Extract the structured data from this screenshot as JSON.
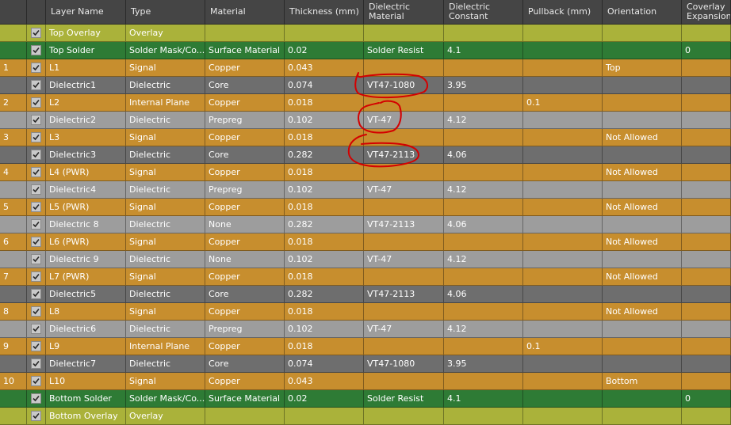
{
  "colors": {
    "overlay": "#aab23a",
    "solder": "#2e7b35",
    "signal": "#c78e2e",
    "dielectric_core": "#6e6e6e",
    "dielectric_prepreg": "#9d9d9d",
    "header": "#454545",
    "annotation": "#d40000"
  },
  "columns": [
    {
      "key": "num",
      "label": ""
    },
    {
      "key": "check",
      "label": ""
    },
    {
      "key": "name",
      "label": "Layer Name"
    },
    {
      "key": "type",
      "label": "Type"
    },
    {
      "key": "material",
      "label": "Material"
    },
    {
      "key": "thickness",
      "label": "Thickness (mm)"
    },
    {
      "key": "diel_material",
      "label": "Dielectric\nMaterial"
    },
    {
      "key": "diel_constant",
      "label": "Dielectric\nConstant"
    },
    {
      "key": "pullback",
      "label": "Pullback (mm)"
    },
    {
      "key": "orientation",
      "label": "Orientation"
    },
    {
      "key": "coverlay",
      "label": "Coverlay\nExpansion"
    }
  ],
  "rows": [
    {
      "style": "overlay",
      "num": "",
      "checked": true,
      "name": "Top Overlay",
      "type": "Overlay",
      "material": "",
      "thickness": "",
      "diel_material": "",
      "diel_constant": "",
      "pullback": "",
      "orientation": "",
      "coverlay": ""
    },
    {
      "style": "solder",
      "num": "",
      "checked": true,
      "name": "Top Solder",
      "type": "Solder Mask/Co...",
      "material": "Surface Material",
      "thickness": "0.02",
      "diel_material": "Solder Resist",
      "diel_constant": "4.1",
      "pullback": "",
      "orientation": "",
      "coverlay": "0"
    },
    {
      "style": "signal",
      "num": "1",
      "checked": true,
      "name": "L1",
      "type": "Signal",
      "material": "Copper",
      "thickness": "0.043",
      "diel_material": "",
      "diel_constant": "",
      "pullback": "",
      "orientation": "Top",
      "coverlay": ""
    },
    {
      "style": "dielectric_core",
      "num": "",
      "checked": true,
      "name": "Dielectric1",
      "type": "Dielectric",
      "material": "Core",
      "thickness": "0.074",
      "diel_material": "VT47-1080",
      "diel_constant": "3.95",
      "pullback": "",
      "orientation": "",
      "coverlay": ""
    },
    {
      "style": "signal",
      "num": "2",
      "checked": true,
      "name": "L2",
      "type": "Internal Plane",
      "material": "Copper",
      "thickness": "0.018",
      "diel_material": "",
      "diel_constant": "",
      "pullback": "0.1",
      "orientation": "",
      "coverlay": ""
    },
    {
      "style": "dielectric_prepreg",
      "num": "",
      "checked": true,
      "name": "Dielectric2",
      "type": "Dielectric",
      "material": "Prepreg",
      "thickness": "0.102",
      "diel_material": "VT-47",
      "diel_constant": "4.12",
      "pullback": "",
      "orientation": "",
      "coverlay": ""
    },
    {
      "style": "signal",
      "num": "3",
      "checked": true,
      "name": "L3",
      "type": "Signal",
      "material": "Copper",
      "thickness": "0.018",
      "diel_material": "",
      "diel_constant": "",
      "pullback": "",
      "orientation": "Not Allowed",
      "coverlay": ""
    },
    {
      "style": "dielectric_core",
      "num": "",
      "checked": true,
      "name": "Dielectric3",
      "type": "Dielectric",
      "material": "Core",
      "thickness": "0.282",
      "diel_material": "VT47-2113",
      "diel_constant": "4.06",
      "pullback": "",
      "orientation": "",
      "coverlay": ""
    },
    {
      "style": "signal",
      "num": "4",
      "checked": true,
      "name": "L4 (PWR)",
      "type": "Signal",
      "material": "Copper",
      "thickness": "0.018",
      "diel_material": "",
      "diel_constant": "",
      "pullback": "",
      "orientation": "Not Allowed",
      "coverlay": ""
    },
    {
      "style": "dielectric_prepreg",
      "num": "",
      "checked": true,
      "name": "Dielectric4",
      "type": "Dielectric",
      "material": "Prepreg",
      "thickness": "0.102",
      "diel_material": "VT-47",
      "diel_constant": "4.12",
      "pullback": "",
      "orientation": "",
      "coverlay": ""
    },
    {
      "style": "signal",
      "num": "5",
      "checked": true,
      "name": "L5 (PWR)",
      "type": "Signal",
      "material": "Copper",
      "thickness": "0.018",
      "diel_material": "",
      "diel_constant": "",
      "pullback": "",
      "orientation": "Not Allowed",
      "coverlay": ""
    },
    {
      "style": "dielectric_prepreg",
      "num": "",
      "checked": true,
      "name": "Dielectric 8",
      "type": "Dielectric",
      "material": "None",
      "thickness": "0.282",
      "diel_material": "VT47-2113",
      "diel_constant": "4.06",
      "pullback": "",
      "orientation": "",
      "coverlay": ""
    },
    {
      "style": "signal",
      "num": "6",
      "checked": true,
      "name": "L6 (PWR)",
      "type": "Signal",
      "material": "Copper",
      "thickness": "0.018",
      "diel_material": "",
      "diel_constant": "",
      "pullback": "",
      "orientation": "Not Allowed",
      "coverlay": ""
    },
    {
      "style": "dielectric_prepreg",
      "num": "",
      "checked": true,
      "name": "Dielectric 9",
      "type": "Dielectric",
      "material": "None",
      "thickness": "0.102",
      "diel_material": "VT-47",
      "diel_constant": "4.12",
      "pullback": "",
      "orientation": "",
      "coverlay": ""
    },
    {
      "style": "signal",
      "num": "7",
      "checked": true,
      "name": "L7 (PWR)",
      "type": "Signal",
      "material": "Copper",
      "thickness": "0.018",
      "diel_material": "",
      "diel_constant": "",
      "pullback": "",
      "orientation": "Not Allowed",
      "coverlay": ""
    },
    {
      "style": "dielectric_core",
      "num": "",
      "checked": true,
      "name": "Dielectric5",
      "type": "Dielectric",
      "material": "Core",
      "thickness": "0.282",
      "diel_material": "VT47-2113",
      "diel_constant": "4.06",
      "pullback": "",
      "orientation": "",
      "coverlay": ""
    },
    {
      "style": "signal",
      "num": "8",
      "checked": true,
      "name": "L8",
      "type": "Signal",
      "material": "Copper",
      "thickness": "0.018",
      "diel_material": "",
      "diel_constant": "",
      "pullback": "",
      "orientation": "Not Allowed",
      "coverlay": ""
    },
    {
      "style": "dielectric_prepreg",
      "num": "",
      "checked": true,
      "name": "Dielectric6",
      "type": "Dielectric",
      "material": "Prepreg",
      "thickness": "0.102",
      "diel_material": "VT-47",
      "diel_constant": "4.12",
      "pullback": "",
      "orientation": "",
      "coverlay": ""
    },
    {
      "style": "signal",
      "num": "9",
      "checked": true,
      "name": "L9",
      "type": "Internal Plane",
      "material": "Copper",
      "thickness": "0.018",
      "diel_material": "",
      "diel_constant": "",
      "pullback": "0.1",
      "orientation": "",
      "coverlay": ""
    },
    {
      "style": "dielectric_core",
      "num": "",
      "checked": true,
      "name": "Dielectric7",
      "type": "Dielectric",
      "material": "Core",
      "thickness": "0.074",
      "diel_material": "VT47-1080",
      "diel_constant": "3.95",
      "pullback": "",
      "orientation": "",
      "coverlay": ""
    },
    {
      "style": "signal",
      "num": "10",
      "checked": true,
      "name": "L10",
      "type": "Signal",
      "material": "Copper",
      "thickness": "0.043",
      "diel_material": "",
      "diel_constant": "",
      "pullback": "",
      "orientation": "Bottom",
      "coverlay": ""
    },
    {
      "style": "solder",
      "num": "",
      "checked": true,
      "name": "Bottom Solder",
      "type": "Solder Mask/Co...",
      "material": "Surface Material",
      "thickness": "0.02",
      "diel_material": "Solder Resist",
      "diel_constant": "4.1",
      "pullback": "",
      "orientation": "",
      "coverlay": "0"
    },
    {
      "style": "overlay",
      "num": "",
      "checked": true,
      "name": "Bottom Overlay",
      "type": "Overlay",
      "material": "",
      "thickness": "",
      "diel_material": "",
      "diel_constant": "",
      "pullback": "",
      "orientation": "",
      "coverlay": ""
    }
  ]
}
